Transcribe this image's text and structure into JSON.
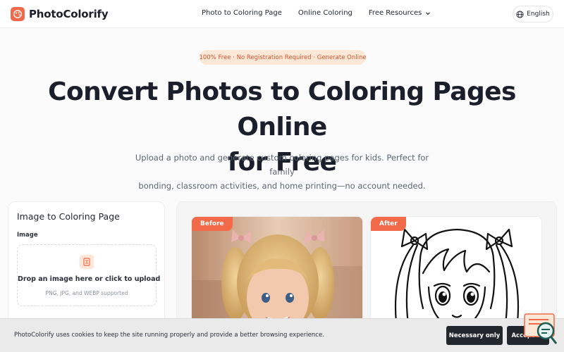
{
  "header": {
    "brand": "PhotoColorify",
    "nav": [
      "Photo to Coloring Page",
      "Online Coloring",
      "Free Resources"
    ],
    "language": "English"
  },
  "hero": {
    "badge": "100% Free · No Registration Required · Generate Online",
    "title_line1": "Convert Photos to Coloring Pages Online",
    "title_line2": "for Free",
    "subtitle_line1": "Upload a photo and generate custom coloring pages for kids. Perfect for family",
    "subtitle_line2": "bonding, classroom activities, and home printing—no account needed."
  },
  "tool": {
    "title": "Image to Coloring Page",
    "image_label": "Image",
    "drop_text": "Drop an image here or click to upload",
    "drop_hint": "PNG, JPG, and WEBP supported"
  },
  "preview": {
    "before_label": "Before",
    "after_label": "After"
  },
  "cookie": {
    "text": "PhotoColorify uses cookies to keep the site running properly and provide a better browsing experience.",
    "necessary_label": "Necessary only",
    "accept_label": "Accept all"
  },
  "colors": {
    "accent": "#f26a4a",
    "badge_bg": "#fde7d6",
    "dark_button": "#22262d"
  }
}
